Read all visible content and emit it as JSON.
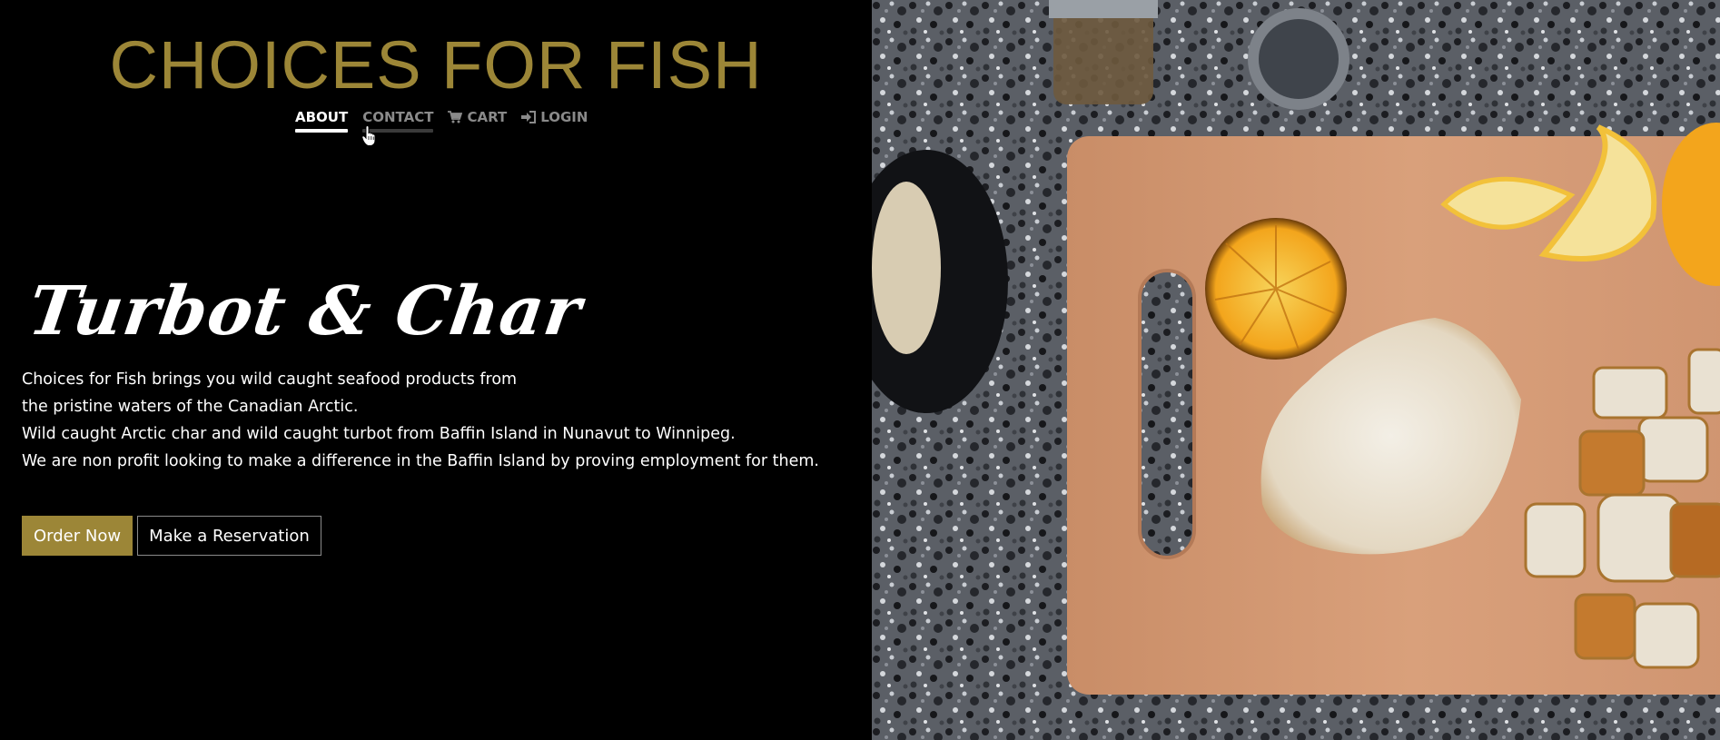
{
  "brand": {
    "title": "CHOICES FOR FISH"
  },
  "nav": {
    "items": [
      {
        "label": "ABOUT",
        "icon": ""
      },
      {
        "label": "CONTACT",
        "icon": ""
      },
      {
        "label": "CART",
        "icon": "shopping-cart-icon"
      },
      {
        "label": "LOGIN",
        "icon": "sign-in-icon"
      }
    ]
  },
  "hero": {
    "title": "Turbot & Char",
    "lines": [
      "Choices for Fish brings you wild caught seafood products from",
      "the pristine waters of the Canadian Arctic.",
      "Wild caught Arctic char and wild caught turbot from Baffin Island in Nunavut to Winnipeg.",
      "We are non profit looking to make a difference in the Baffin Island by proving employment for them."
    ],
    "buttons": {
      "order_label": "Order Now",
      "reservation_label": "Make a Reservation"
    }
  },
  "colors": {
    "accent": "#9c8637",
    "background": "#000000",
    "nav_inactive": "#8a8a8a",
    "text": "#ffffff"
  }
}
